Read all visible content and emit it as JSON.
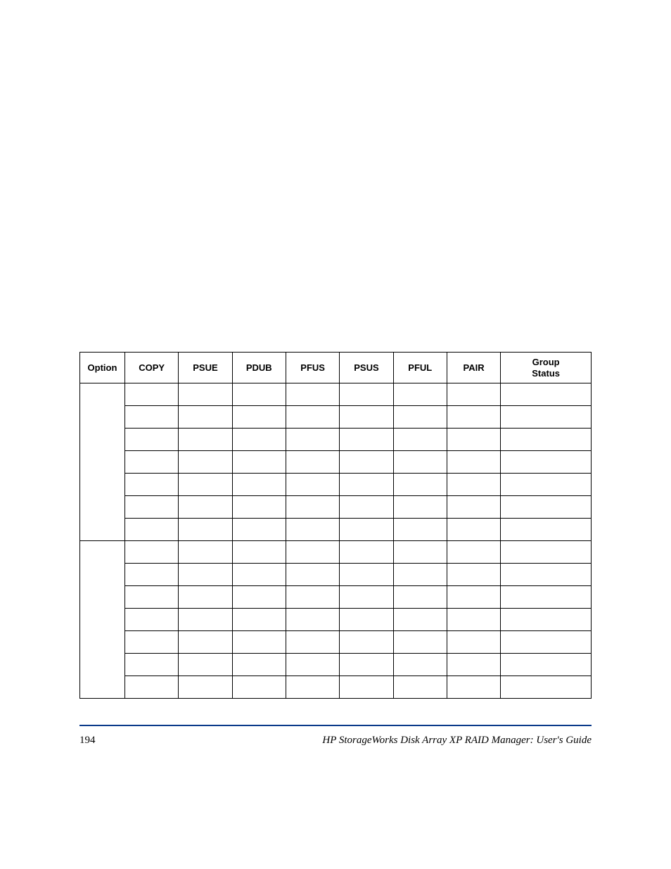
{
  "table": {
    "headers": [
      "Option",
      "COPY",
      "PSUE",
      "PDUB",
      "PFUS",
      "PSUS",
      "PFUL",
      "PAIR",
      "Group Status"
    ],
    "groups": [
      {
        "rows": 7
      },
      {
        "rows": 7
      }
    ]
  },
  "footer": {
    "page_number": "194",
    "doc_title": "HP StorageWorks Disk Array XP RAID Manager: User's Guide"
  }
}
